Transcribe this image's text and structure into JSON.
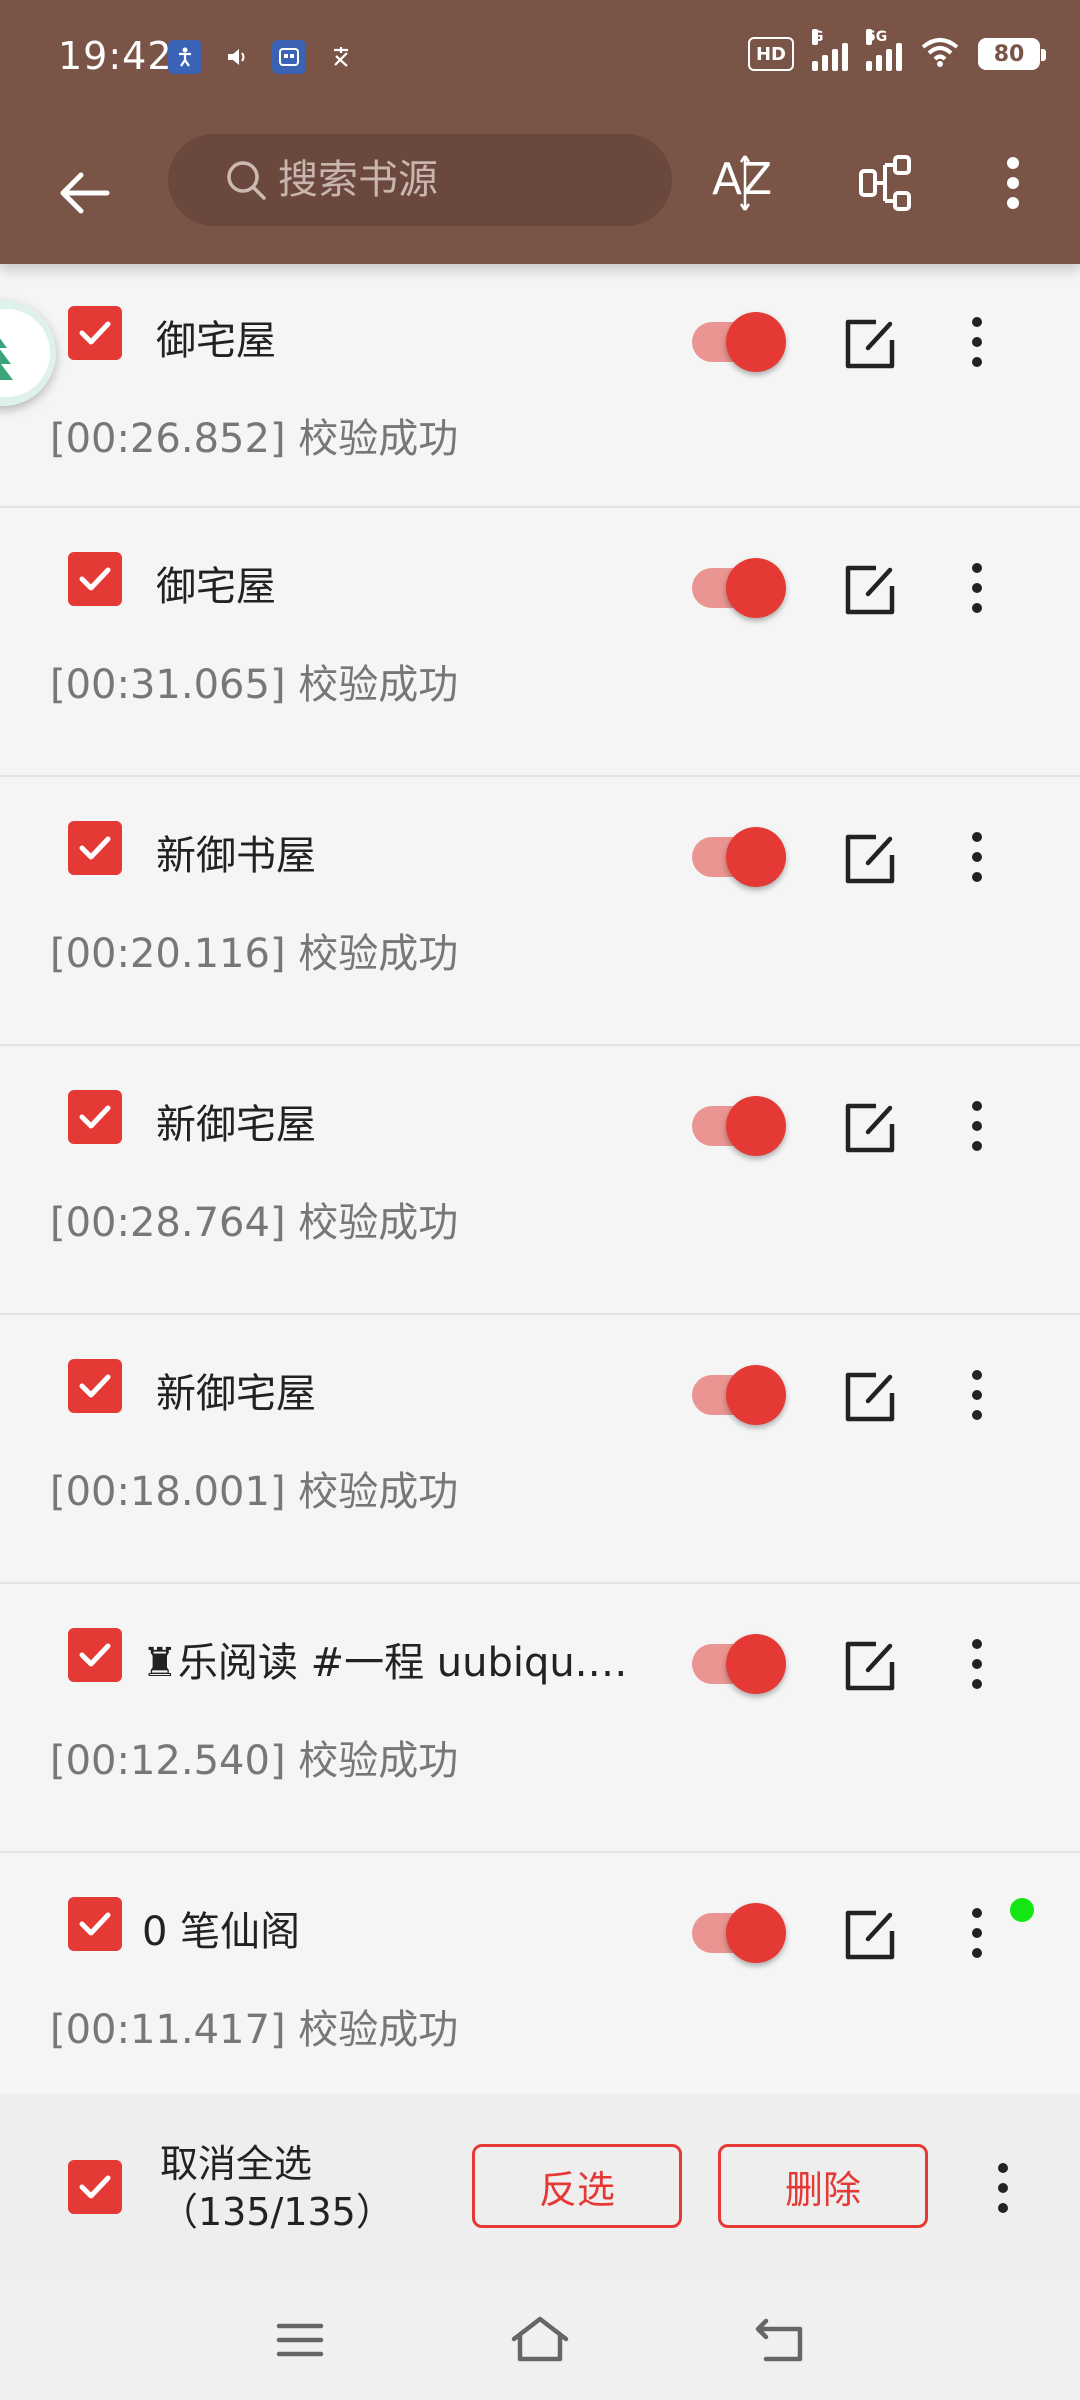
{
  "status": {
    "time": "19:42",
    "battery": "80",
    "hd": "HD",
    "sig1_label": "G",
    "sig2_label": "5G"
  },
  "toolbar": {
    "search_placeholder": "搜索书源",
    "sort_label": "AZ"
  },
  "sources": [
    {
      "name": "御宅屋",
      "message": "[00:26.852] 校验成功",
      "checked": true,
      "enabled": true
    },
    {
      "name": "御宅屋",
      "message": "[00:31.065] 校验成功",
      "checked": true,
      "enabled": true
    },
    {
      "name": "新御书屋",
      "message": "[00:20.116] 校验成功",
      "checked": true,
      "enabled": true
    },
    {
      "name": "新御宅屋",
      "message": "[00:28.764] 校验成功",
      "checked": true,
      "enabled": true
    },
    {
      "name": "新御宅屋",
      "message": "[00:18.001] 校验成功",
      "checked": true,
      "enabled": true
    },
    {
      "name": "♜乐阅读 #一程 uubiqu.c…",
      "message": "[00:12.540] 校验成功",
      "checked": true,
      "enabled": true
    },
    {
      "name": "0 笔仙阁",
      "message": "[00:11.417] 校验成功",
      "checked": true,
      "enabled": true
    }
  ],
  "selection": {
    "label": "取消全选",
    "count": "（135/135）",
    "invert_label": "反选",
    "delete_label": "删除"
  },
  "colors": {
    "header": "#7a5446",
    "accent": "#e53935",
    "switch_track": "#eb9592"
  }
}
